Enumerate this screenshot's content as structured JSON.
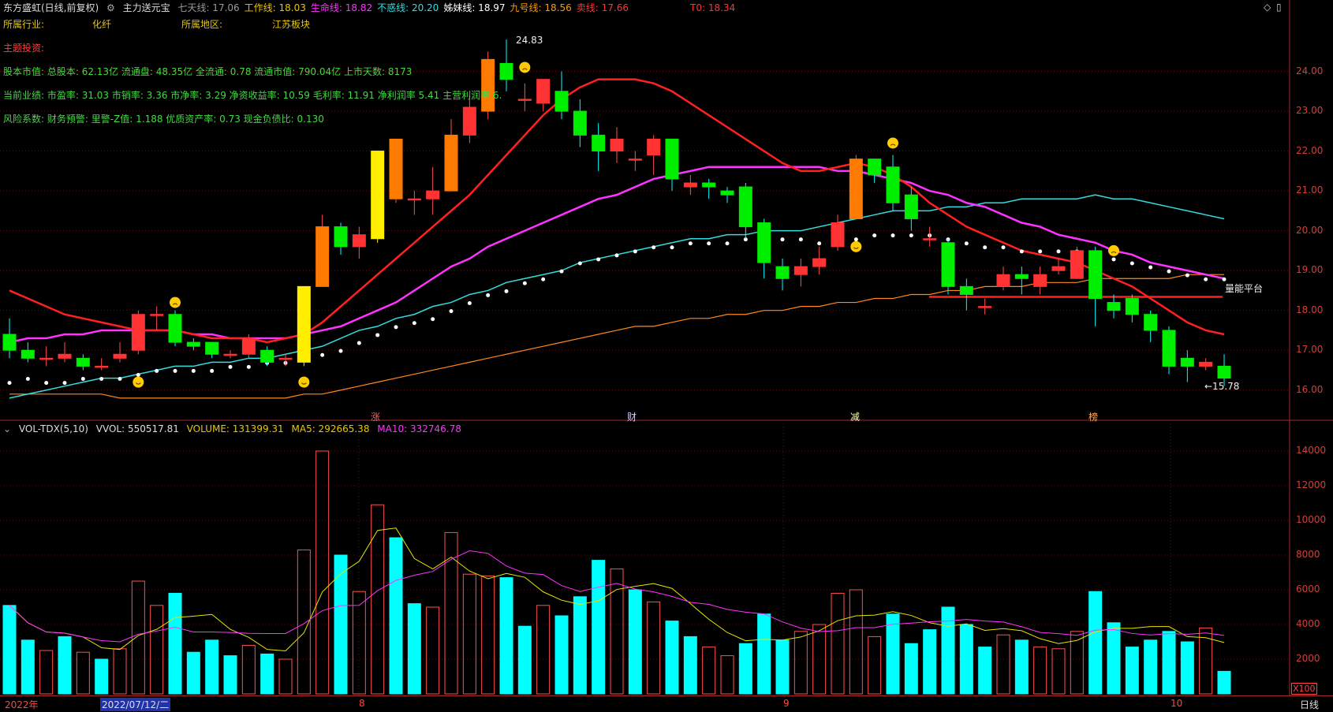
{
  "header": {
    "stock_title": "东方盛虹(日线,前复权)",
    "indicator_name": "主力送元宝",
    "lines": [
      {
        "label": "七天线:",
        "value": "17.06",
        "color": "#9a9a9a"
      },
      {
        "label": "工作线:",
        "value": "18.03",
        "color": "#e6c700"
      },
      {
        "label": "生命线:",
        "value": "18.82",
        "color": "#ff33ff"
      },
      {
        "label": "不惑线:",
        "value": "20.20",
        "color": "#33dddd"
      },
      {
        "label": "姊妹线:",
        "value": "18.97",
        "color": "#ffffff"
      },
      {
        "label": "九号线:",
        "value": "18.56",
        "color": "#ff9900"
      },
      {
        "label": "卖线:",
        "value": "17.66",
        "color": "#ff3333"
      }
    ],
    "t0": "T0: 18.34"
  },
  "info": {
    "industry_label": "所属行业:",
    "industry_value": "化纤",
    "region_label": "所属地区:",
    "region_value": "",
    "sector_value": "江苏板块",
    "theme_label": "主题投资:",
    "row1": "股本市值: 总股本: 62.13亿 流通盘: 48.35亿 全流通: 0.78 流通市值: 790.04亿 上市天数: 8173",
    "row2": "当前业绩: 市盈率: 31.03 市销率: 3.36 市净率: 3.29 净资收益率: 10.59 毛利率: 11.91 净利润率 5.41 主营利润率 6.",
    "row3": "风险系数: 财务预警: 里警-Z值: 1.188 优质资产率: 0.73 现金负债比: 0.130"
  },
  "price_axis": [
    "24.00",
    "23.00",
    "22.00",
    "21.00",
    "20.00",
    "19.00",
    "18.00",
    "17.00",
    "16.00"
  ],
  "annotations": {
    "high": "24.83",
    "low": "←15.78",
    "platform": "量能平台"
  },
  "event_markers": [
    "涨",
    "财",
    "减",
    "榜"
  ],
  "volume": {
    "title": "VOL-TDX(5,10)",
    "vvol": "VVOL: 550517.81",
    "volume": "VOLUME: 131399.31",
    "ma5": "MA5: 292665.38",
    "ma10": "MA10: 332746.78",
    "axis": [
      "14000",
      "12000",
      "10000",
      "8000",
      "6000",
      "4000",
      "2000"
    ],
    "unit": "X100"
  },
  "bottom_bar": {
    "year": "2022年",
    "cursor_date": "2022/07/12/二",
    "m8": "8",
    "m9": "9",
    "m10": "10",
    "period": "日线"
  },
  "colors": {
    "up": "#ff3333",
    "down": "#00ee00",
    "orange": "#ff7a00",
    "yellow": "#ffee00",
    "cyan": "#00ffff"
  },
  "chart_data": {
    "type": "candlestick",
    "price_ylim": [
      15.5,
      25.0
    ],
    "volume_ylim": [
      0,
      15000
    ],
    "candles": [
      [
        17.4,
        17.0,
        17.8,
        16.8
      ],
      [
        17.0,
        16.8,
        17.2,
        16.7
      ],
      [
        16.8,
        16.8,
        17.1,
        16.6
      ],
      [
        16.8,
        16.9,
        17.2,
        16.7
      ],
      [
        16.8,
        16.6,
        16.9,
        16.5
      ],
      [
        16.6,
        16.6,
        16.8,
        16.5
      ],
      [
        16.8,
        16.9,
        17.2,
        16.7
      ],
      [
        17.0,
        17.9,
        18.0,
        16.9
      ],
      [
        17.9,
        17.9,
        18.1,
        17.5
      ],
      [
        17.9,
        17.2,
        18.0,
        17.1
      ],
      [
        17.2,
        17.1,
        17.3,
        17.0
      ],
      [
        17.2,
        16.9,
        17.2,
        16.8
      ],
      [
        16.9,
        16.9,
        17.0,
        16.8
      ],
      [
        16.9,
        17.3,
        17.4,
        16.8
      ],
      [
        17.0,
        16.7,
        17.1,
        16.6
      ],
      [
        16.8,
        16.8,
        16.9,
        16.6
      ],
      [
        16.7,
        18.6,
        18.6,
        16.6
      ],
      [
        18.6,
        20.1,
        20.4,
        18.6
      ],
      [
        20.1,
        19.6,
        20.2,
        19.4
      ],
      [
        19.6,
        19.9,
        20.1,
        19.3
      ],
      [
        19.8,
        22.0,
        22.0,
        19.7
      ],
      [
        20.8,
        22.3,
        22.3,
        20.7
      ],
      [
        20.8,
        20.8,
        21.0,
        20.4
      ],
      [
        20.8,
        21.0,
        21.6,
        20.4
      ],
      [
        21.0,
        22.4,
        22.8,
        21.0
      ],
      [
        22.4,
        23.1,
        23.4,
        22.2
      ],
      [
        23.0,
        24.3,
        24.5,
        22.8
      ],
      [
        24.2,
        23.8,
        24.8,
        23.5
      ],
      [
        23.3,
        23.3,
        23.7,
        23.0
      ],
      [
        23.2,
        23.8,
        23.8,
        23.0
      ],
      [
        23.5,
        23.0,
        24.0,
        22.8
      ],
      [
        23.0,
        22.4,
        23.3,
        22.1
      ],
      [
        22.4,
        22.0,
        22.7,
        21.5
      ],
      [
        22.0,
        22.3,
        22.6,
        21.7
      ],
      [
        21.8,
        21.8,
        22.0,
        21.5
      ],
      [
        21.9,
        22.3,
        22.4,
        21.4
      ],
      [
        22.3,
        21.3,
        22.3,
        21.0
      ],
      [
        21.1,
        21.2,
        21.4,
        20.9
      ],
      [
        21.2,
        21.1,
        21.3,
        20.8
      ],
      [
        21.0,
        20.9,
        21.1,
        20.7
      ],
      [
        21.1,
        20.1,
        21.2,
        19.8
      ],
      [
        20.2,
        19.2,
        20.3,
        18.8
      ],
      [
        19.1,
        18.8,
        19.3,
        18.5
      ],
      [
        18.9,
        19.1,
        19.3,
        18.6
      ],
      [
        19.1,
        19.3,
        19.6,
        18.9
      ],
      [
        19.6,
        20.2,
        20.4,
        19.5
      ],
      [
        20.3,
        21.8,
        21.9,
        20.3
      ],
      [
        21.8,
        21.4,
        21.8,
        21.2
      ],
      [
        21.6,
        20.7,
        21.9,
        20.5
      ],
      [
        20.9,
        20.3,
        21.1,
        20.0
      ],
      [
        19.8,
        19.8,
        20.1,
        19.6
      ],
      [
        19.7,
        18.6,
        19.8,
        18.4
      ],
      [
        18.6,
        18.4,
        18.8,
        18.0
      ],
      [
        18.1,
        18.1,
        18.3,
        17.9
      ],
      [
        18.6,
        18.9,
        19.1,
        18.5
      ],
      [
        18.9,
        18.8,
        19.1,
        18.4
      ],
      [
        18.6,
        18.9,
        19.1,
        18.4
      ],
      [
        19.0,
        19.1,
        19.3,
        18.9
      ],
      [
        18.8,
        19.5,
        19.6,
        18.8
      ],
      [
        19.5,
        18.3,
        19.6,
        17.6
      ],
      [
        18.2,
        18.0,
        18.4,
        17.8
      ],
      [
        18.3,
        17.9,
        18.4,
        17.7
      ],
      [
        17.9,
        17.5,
        18.0,
        17.2
      ],
      [
        17.5,
        16.6,
        17.6,
        16.4
      ],
      [
        16.8,
        16.6,
        17.0,
        16.2
      ],
      [
        16.6,
        16.7,
        16.8,
        16.5
      ],
      [
        16.6,
        16.3,
        16.9,
        16.1
      ]
    ],
    "volumes": [
      [
        5100,
        -1
      ],
      [
        3100,
        -1
      ],
      [
        2500,
        1
      ],
      [
        3300,
        -1
      ],
      [
        2400,
        1
      ],
      [
        2000,
        -1
      ],
      [
        2600,
        1
      ],
      [
        6500,
        1
      ],
      [
        5100,
        1
      ],
      [
        5800,
        -1
      ],
      [
        2400,
        -1
      ],
      [
        3100,
        -1
      ],
      [
        2200,
        -1
      ],
      [
        2800,
        1
      ],
      [
        2300,
        -1
      ],
      [
        2000,
        1
      ],
      [
        8300,
        1
      ],
      [
        14000,
        1
      ],
      [
        8000,
        -1
      ],
      [
        5900,
        1
      ],
      [
        10900,
        1
      ],
      [
        9000,
        -1
      ],
      [
        5200,
        -1
      ],
      [
        5000,
        1
      ],
      [
        9300,
        1
      ],
      [
        6900,
        1
      ],
      [
        6800,
        1
      ],
      [
        6700,
        -1
      ],
      [
        3900,
        -1
      ],
      [
        5100,
        1
      ],
      [
        4500,
        -1
      ],
      [
        5600,
        -1
      ],
      [
        7700,
        -1
      ],
      [
        7200,
        1
      ],
      [
        6000,
        -1
      ],
      [
        5300,
        1
      ],
      [
        4200,
        -1
      ],
      [
        3300,
        -1
      ],
      [
        2700,
        1
      ],
      [
        2200,
        1
      ],
      [
        2900,
        -1
      ],
      [
        4600,
        -1
      ],
      [
        3100,
        -1
      ],
      [
        3600,
        1
      ],
      [
        4000,
        1
      ],
      [
        5800,
        1
      ],
      [
        6000,
        1
      ],
      [
        3300,
        1
      ],
      [
        4600,
        -1
      ],
      [
        2900,
        -1
      ],
      [
        3700,
        -1
      ],
      [
        5000,
        -1
      ],
      [
        4000,
        -1
      ],
      [
        2700,
        -1
      ],
      [
        3400,
        1
      ],
      [
        3100,
        -1
      ],
      [
        2700,
        1
      ],
      [
        2600,
        1
      ],
      [
        3600,
        1
      ],
      [
        5900,
        -1
      ],
      [
        4100,
        -1
      ],
      [
        2700,
        -1
      ],
      [
        3100,
        -1
      ],
      [
        3600,
        -1
      ],
      [
        3000,
        -1
      ],
      [
        3800,
        1
      ],
      [
        1300,
        -1
      ]
    ],
    "white_dots": [
      16.3,
      16.4,
      16.3,
      16.3,
      16.4,
      16.4,
      16.4,
      16.5,
      16.6,
      16.6,
      16.6,
      16.6,
      16.7,
      16.7,
      16.8,
      16.8,
      16.9,
      17.0,
      17.1,
      17.3,
      17.5,
      17.7,
      17.8,
      17.9,
      18.1,
      18.3,
      18.5,
      18.6,
      18.8,
      18.9,
      19.1,
      19.3,
      19.4,
      19.5,
      19.6,
      19.7,
      19.7,
      19.8,
      19.8,
      19.8,
      19.9,
      19.9,
      19.9,
      19.9,
      19.8,
      19.9,
      19.9,
      20.0,
      20.0,
      20.0,
      20.0,
      19.9,
      19.8,
      19.7,
      19.7,
      19.6,
      19.6,
      19.6,
      19.6,
      19.5,
      19.4,
      19.3,
      19.2,
      19.1,
      19.0,
      18.9,
      18.9
    ],
    "ma_red": [
      18.5,
      18.3,
      18.1,
      17.9,
      17.8,
      17.7,
      17.6,
      17.5,
      17.5,
      17.5,
      17.4,
      17.3,
      17.3,
      17.3,
      17.2,
      17.3,
      17.4,
      17.7,
      18.1,
      18.5,
      18.9,
      19.3,
      19.7,
      20.1,
      20.5,
      20.9,
      21.4,
      21.9,
      22.4,
      22.9,
      23.3,
      23.6,
      23.8,
      23.8,
      23.8,
      23.7,
      23.5,
      23.2,
      22.9,
      22.6,
      22.3,
      22.0,
      21.7,
      21.5,
      21.5,
      21.6,
      21.7,
      21.6,
      21.4,
      21.1,
      20.7,
      20.4,
      20.1,
      19.9,
      19.7,
      19.5,
      19.4,
      19.3,
      19.2,
      19.0,
      18.8,
      18.6,
      18.3,
      18.0,
      17.7,
      17.5,
      17.4
    ],
    "ma_magenta": [
      17.2,
      17.3,
      17.3,
      17.4,
      17.4,
      17.5,
      17.5,
      17.5,
      17.5,
      17.5,
      17.4,
      17.4,
      17.3,
      17.3,
      17.3,
      17.3,
      17.4,
      17.5,
      17.6,
      17.8,
      18.0,
      18.2,
      18.5,
      18.8,
      19.1,
      19.3,
      19.6,
      19.8,
      20.0,
      20.2,
      20.4,
      20.6,
      20.8,
      20.9,
      21.1,
      21.3,
      21.4,
      21.5,
      21.6,
      21.6,
      21.6,
      21.6,
      21.6,
      21.6,
      21.6,
      21.5,
      21.5,
      21.4,
      21.3,
      21.2,
      21.0,
      20.9,
      20.7,
      20.6,
      20.4,
      20.2,
      20.1,
      19.9,
      19.8,
      19.7,
      19.5,
      19.4,
      19.2,
      19.1,
      19.0,
      18.9,
      18.8
    ],
    "ma_cyan": [
      15.8,
      15.9,
      16.0,
      16.1,
      16.2,
      16.3,
      16.3,
      16.4,
      16.5,
      16.6,
      16.6,
      16.7,
      16.7,
      16.8,
      16.8,
      16.9,
      17.0,
      17.1,
      17.3,
      17.5,
      17.6,
      17.8,
      17.9,
      18.1,
      18.2,
      18.4,
      18.5,
      18.7,
      18.8,
      18.9,
      19.0,
      19.2,
      19.3,
      19.4,
      19.5,
      19.6,
      19.7,
      19.8,
      19.8,
      19.9,
      19.9,
      20.0,
      20.0,
      20.0,
      20.1,
      20.2,
      20.3,
      20.4,
      20.5,
      20.5,
      20.5,
      20.6,
      20.6,
      20.7,
      20.7,
      20.8,
      20.8,
      20.8,
      20.8,
      20.9,
      20.8,
      20.8,
      20.7,
      20.6,
      20.5,
      20.4,
      20.3
    ],
    "ma_orange": [
      15.9,
      15.9,
      15.9,
      15.9,
      15.9,
      15.9,
      15.8,
      15.8,
      15.8,
      15.8,
      15.8,
      15.8,
      15.8,
      15.8,
      15.8,
      15.8,
      15.9,
      15.9,
      16.0,
      16.1,
      16.2,
      16.3,
      16.4,
      16.5,
      16.6,
      16.7,
      16.8,
      16.9,
      17.0,
      17.1,
      17.2,
      17.3,
      17.4,
      17.5,
      17.6,
      17.6,
      17.7,
      17.8,
      17.8,
      17.9,
      17.9,
      18.0,
      18.0,
      18.1,
      18.1,
      18.2,
      18.2,
      18.3,
      18.3,
      18.4,
      18.4,
      18.5,
      18.5,
      18.6,
      18.6,
      18.6,
      18.7,
      18.7,
      18.7,
      18.8,
      18.8,
      18.8,
      18.8,
      18.8,
      18.9,
      18.9,
      18.9
    ]
  }
}
